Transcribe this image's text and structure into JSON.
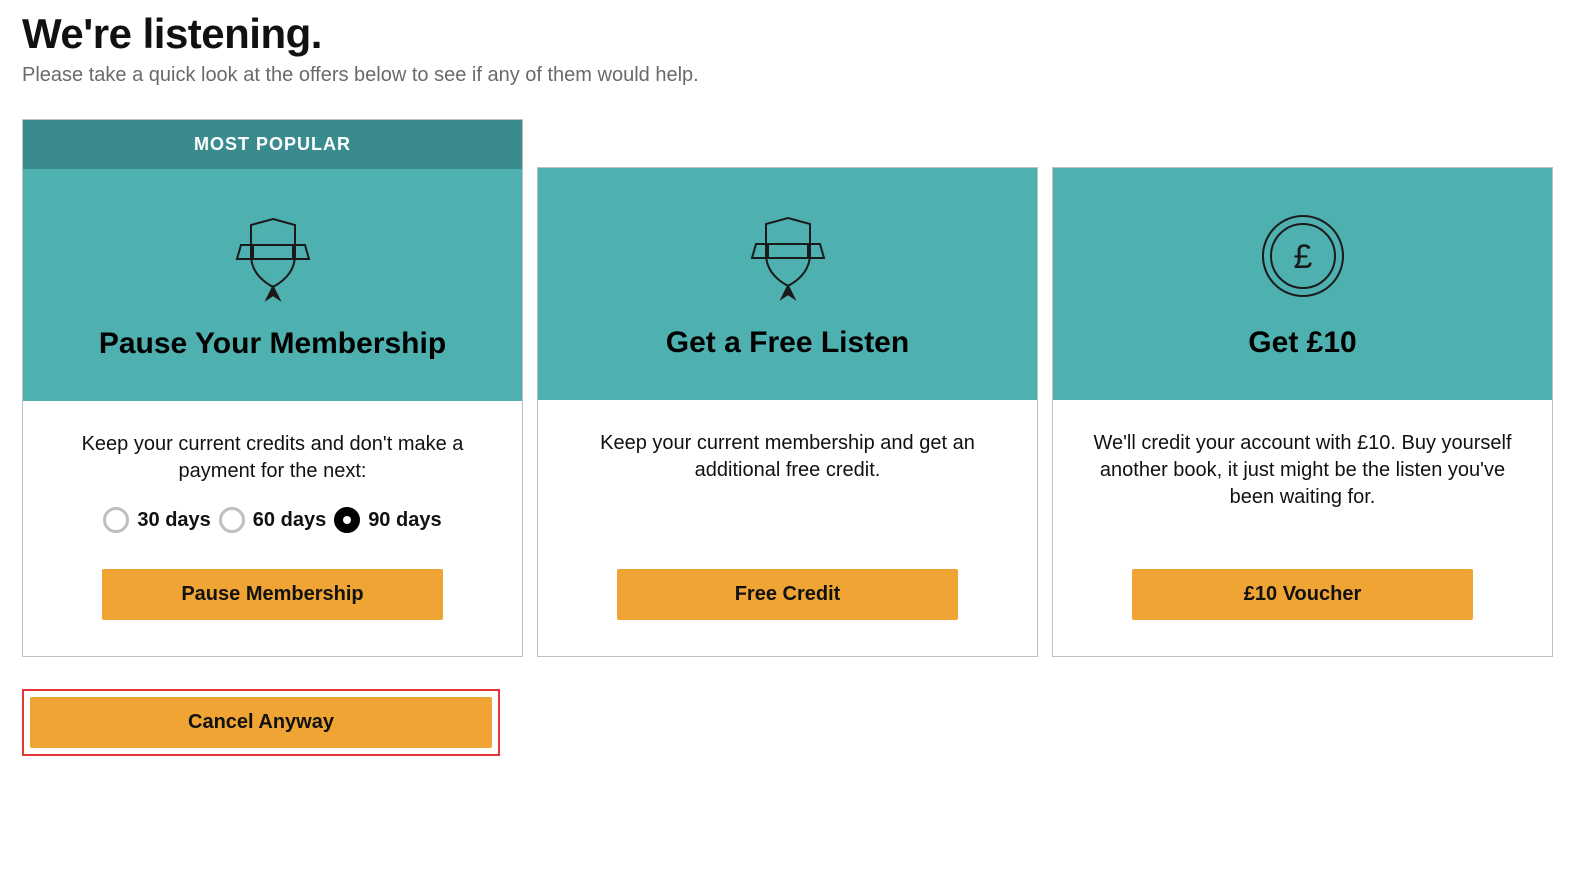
{
  "header": {
    "title": "We're listening.",
    "subtitle": "Please take a quick look at the offers below to see if any of them would help."
  },
  "cards": {
    "pause": {
      "badge": "MOST POPULAR",
      "title": "Pause Your Membership",
      "desc": "Keep your current credits and don't make a payment for the next:",
      "options": {
        "opt0": "30 days",
        "opt1": "60 days",
        "opt2": "90 days",
        "selected_index": 2
      },
      "cta": "Pause Membership"
    },
    "free_listen": {
      "title": "Get a Free Listen",
      "desc": "Keep your current membership and get an additional free credit.",
      "cta": "Free Credit"
    },
    "voucher": {
      "title": "Get £10",
      "desc": "We'll credit your account with £10. Buy yourself another book, it just might be the listen you've been waiting for.",
      "cta": "£10 Voucher"
    }
  },
  "footer": {
    "cancel": "Cancel Anyway"
  }
}
